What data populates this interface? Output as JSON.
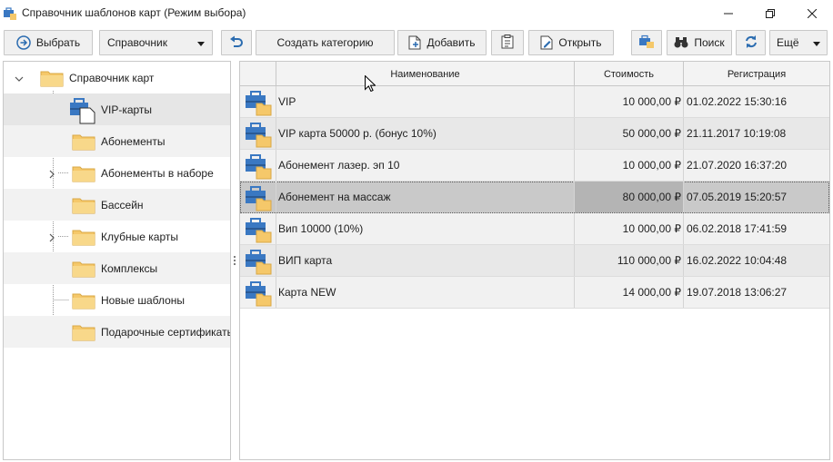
{
  "window": {
    "title": "Справочник шаблонов карт (Режим выбора)"
  },
  "toolbar": {
    "select_label": "Выбрать",
    "directory_dropdown": "Справочник",
    "create_category_label": "Создать категорию",
    "add_label": "Добавить",
    "open_label": "Открыть",
    "search_label": "Поиск",
    "more_dropdown": "Ещё"
  },
  "tree": {
    "root_label": "Справочник карт",
    "items": [
      {
        "label": "VIP-карты"
      },
      {
        "label": "Абонементы"
      },
      {
        "label": "Абонементы в наборе"
      },
      {
        "label": "Бассейн"
      },
      {
        "label": "Клубные карты"
      },
      {
        "label": "Комплексы"
      },
      {
        "label": "Новые шаблоны"
      },
      {
        "label": "Подарочные сертификаты"
      }
    ]
  },
  "grid": {
    "columns": [
      "Наименование",
      "Стоимость",
      "Регистрация"
    ],
    "rows": [
      {
        "name": "VIP",
        "cost": "10 000,00 ₽",
        "reg": "01.02.2022 15:30:16"
      },
      {
        "name": "VIP карта 50000 р. (бонус 10%)",
        "cost": "50 000,00 ₽",
        "reg": "21.11.2017 10:19:08"
      },
      {
        "name": "Абонемент лазер. эп  10",
        "cost": "10 000,00 ₽",
        "reg": "21.07.2020 16:37:20"
      },
      {
        "name": "Абонемент на массаж",
        "cost": "80 000,00 ₽",
        "reg": "07.05.2019 15:20:57"
      },
      {
        "name": "Вип 10000 (10%)",
        "cost": "10 000,00 ₽",
        "reg": "06.02.2018 17:41:59"
      },
      {
        "name": "ВИП карта",
        "cost": "110 000,00 ₽",
        "reg": "16.02.2022 10:04:48"
      },
      {
        "name": "Карта NEW",
        "cost": "14 000,00 ₽",
        "reg": "19.07.2018 13:06:27"
      }
    ]
  },
  "colors": {
    "accent_blue": "#2b6cb0",
    "folder_yellow": "#f5c86a",
    "selection_gray": "#c9c9c9"
  }
}
